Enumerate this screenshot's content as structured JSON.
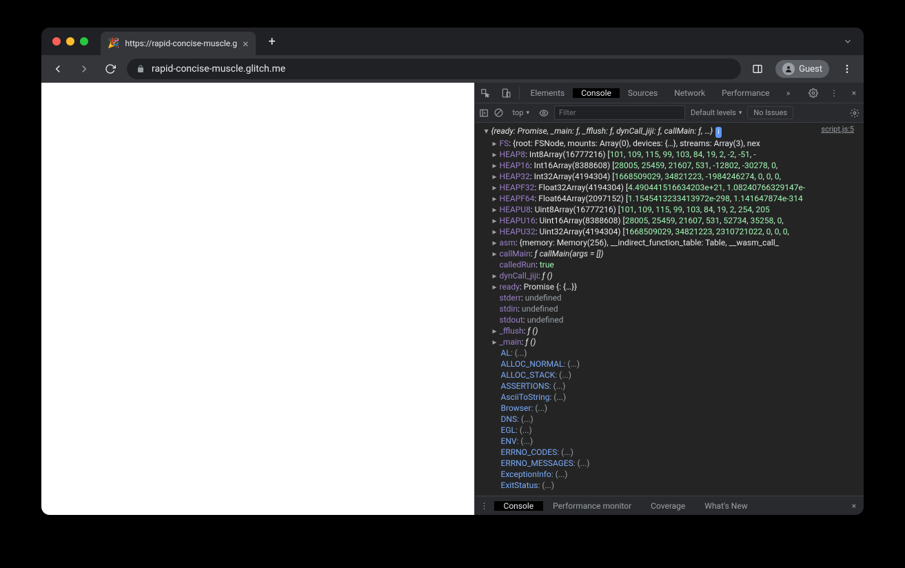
{
  "browser": {
    "tab_title": "https://rapid-concise-muscle.g",
    "tab_favicon": "🎉",
    "url": "rapid-concise-muscle.glitch.me",
    "guest_label": "Guest"
  },
  "devtools": {
    "tabs": [
      "Elements",
      "Console",
      "Sources",
      "Network",
      "Performance"
    ],
    "active_tab": "Console",
    "context": "top",
    "filter_placeholder": "Filter",
    "levels": "Default levels",
    "issues": "No Issues",
    "source_link": "script.js:5",
    "drawer_tabs": [
      "Console",
      "Performance monitor",
      "Coverage",
      "What's New"
    ],
    "drawer_active": "Console"
  },
  "console": {
    "summary_open": "{ready: Promise, _main: ƒ, _fflush: ƒ, dynCall_jiji: ƒ, callMain: ƒ, …}",
    "lines": [
      {
        "t": "obj",
        "key": "FS",
        "val": ": {root: FSNode, mounts: Array(0), devices: {…}, streams: Array(3), nex"
      },
      {
        "t": "arr",
        "key": "HEAP8",
        "cls": "Int8Array(16777216)",
        "nums": [
          "101",
          "109",
          "115",
          "99",
          "103",
          "84",
          "19",
          "2",
          "-2",
          "-51",
          "-"
        ]
      },
      {
        "t": "arr",
        "key": "HEAP16",
        "cls": "Int16Array(8388608)",
        "nums": [
          "28005",
          "25459",
          "21607",
          "531",
          "-12802",
          "-30278",
          "0",
          ""
        ]
      },
      {
        "t": "arr",
        "key": "HEAP32",
        "cls": "Int32Array(4194304)",
        "nums": [
          "1668509029",
          "34821223",
          "-1984246274",
          "0",
          "0",
          "0",
          ""
        ]
      },
      {
        "t": "arr",
        "key": "HEAPF32",
        "cls": "Float32Array(4194304)",
        "nums": [
          "4.490441516634203e+21",
          "1.08240766329147e-"
        ]
      },
      {
        "t": "arr",
        "key": "HEAPF64",
        "cls": "Float64Array(2097152)",
        "nums": [
          "1.1545413233413972e-298",
          "1.141647874e-314"
        ]
      },
      {
        "t": "arr",
        "key": "HEAPU8",
        "cls": "Uint8Array(16777216)",
        "nums": [
          "101",
          "109",
          "115",
          "99",
          "103",
          "84",
          "19",
          "2",
          "254",
          "205"
        ]
      },
      {
        "t": "arr",
        "key": "HEAPU16",
        "cls": "Uint16Array(8388608)",
        "nums": [
          "28005",
          "25459",
          "21607",
          "531",
          "52734",
          "35258",
          "0",
          ""
        ]
      },
      {
        "t": "arr",
        "key": "HEAPU32",
        "cls": "Uint32Array(4194304)",
        "nums": [
          "1668509029",
          "34821223",
          "2310721022",
          "0",
          "0",
          "0",
          ""
        ]
      },
      {
        "t": "obj",
        "key": "asm",
        "val": ": {memory: Memory(256), __indirect_function_table: Table, __wasm_call_"
      },
      {
        "t": "fn",
        "key": "callMain",
        "sig": "callMain(args = [])"
      },
      {
        "t": "kv",
        "key": "calledRun",
        "val": "true",
        "cls": "n"
      },
      {
        "t": "fn",
        "key": "dynCall_jiji",
        "sig": "()"
      },
      {
        "t": "kv",
        "key": "ready",
        "val": "Promise {<fulfilled>: {…}}",
        "cls": "s"
      },
      {
        "t": "kv",
        "key": "stderr",
        "val": "undefined",
        "cls": "g"
      },
      {
        "t": "kv",
        "key": "stdin",
        "val": "undefined",
        "cls": "g"
      },
      {
        "t": "kv",
        "key": "stdout",
        "val": "undefined",
        "cls": "g"
      },
      {
        "t": "fn",
        "key": "_fflush",
        "sig": "()"
      },
      {
        "t": "fn",
        "key": "_main",
        "sig": "()"
      },
      {
        "t": "lazy",
        "key": "AL"
      },
      {
        "t": "lazy",
        "key": "ALLOC_NORMAL"
      },
      {
        "t": "lazy",
        "key": "ALLOC_STACK"
      },
      {
        "t": "lazy",
        "key": "ASSERTIONS"
      },
      {
        "t": "lazy",
        "key": "AsciiToString"
      },
      {
        "t": "lazy",
        "key": "Browser"
      },
      {
        "t": "lazy",
        "key": "DNS"
      },
      {
        "t": "lazy",
        "key": "EGL"
      },
      {
        "t": "lazy",
        "key": "ENV"
      },
      {
        "t": "lazy",
        "key": "ERRNO_CODES"
      },
      {
        "t": "lazy",
        "key": "ERRNO_MESSAGES"
      },
      {
        "t": "lazy",
        "key": "ExceptionInfo"
      },
      {
        "t": "lazy",
        "key": "ExitStatus"
      }
    ]
  }
}
